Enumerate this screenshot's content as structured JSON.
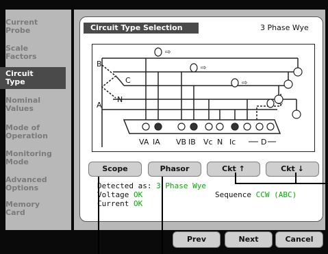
{
  "sidebar": {
    "items": [
      {
        "label": "Current\nProbe",
        "active": false
      },
      {
        "label": "Scale\nFactors",
        "active": false
      },
      {
        "label": "Circuit\nType",
        "active": true
      },
      {
        "label": "Nominal\nValues",
        "active": false
      },
      {
        "label": "Mode of\nOperation",
        "active": false
      },
      {
        "label": "Monitoring\nMode",
        "active": false
      },
      {
        "label": "Advanced\nOptions",
        "active": false
      },
      {
        "label": "Memory\nCard",
        "active": false
      }
    ]
  },
  "screen": {
    "title": "Circuit Type Selection",
    "circuit_config": "3 Phase Wye"
  },
  "diagram": {
    "line_labels": [
      "B",
      "C",
      "N",
      "A"
    ],
    "terminal_labels": [
      "VA",
      "IA",
      "VB",
      "IB",
      "Vc",
      "N",
      "Ic",
      "D"
    ]
  },
  "buttons": {
    "scope": "Scope",
    "phasor": "Phasor",
    "ckt_up": "Ckt ↑",
    "ckt_down": "Ckt ↓"
  },
  "status": {
    "detected_label": "Detected as:",
    "detected_value": "3 Phase Wye",
    "voltage_label": "Voltage",
    "voltage_value": "OK",
    "current_label": "Current",
    "current_value": "OK",
    "sequence_label": "Sequence",
    "sequence_value": "CCW (ABC)"
  },
  "footer": {
    "prev": "Prev",
    "next": "Next",
    "cancel": "Cancel"
  },
  "colors": {
    "ok_green": "#00b000",
    "panel_gray": "#b8b8b8",
    "active_dark": "#4a4a4a"
  }
}
